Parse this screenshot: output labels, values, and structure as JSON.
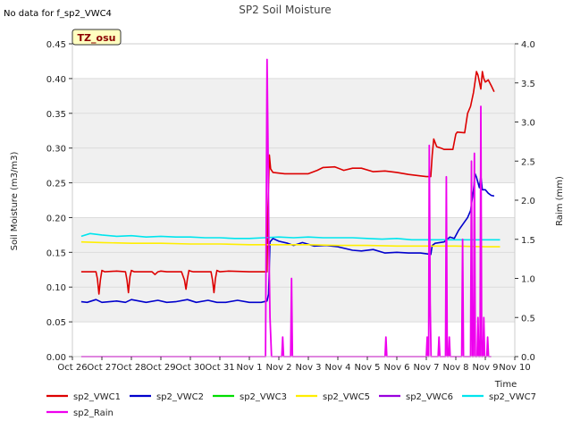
{
  "chart_data": {
    "type": "line",
    "title": "SP2 Soil Moisture",
    "nodata_note": "No data for f_sp2_VWC4",
    "station_tag": "TZ_osu",
    "xlabel": "Time",
    "ylabel": "Soil Moisture (m3/m3)",
    "y2label": "Raim (mm)",
    "xlim": [
      0,
      15
    ],
    "ylim": [
      0.0,
      0.45
    ],
    "y2lim": [
      0.0,
      4.0
    ],
    "x_ticks": [
      0,
      1,
      2,
      3,
      4,
      5,
      6,
      7,
      8,
      9,
      10,
      11,
      12,
      13,
      14,
      15
    ],
    "x_tick_labels": [
      "Oct 26",
      "Oct 27",
      "Oct 28",
      "Oct 29",
      "Oct 30",
      "Oct 31",
      "Nov 1",
      "Nov 2",
      "Nov 3",
      "Nov 4",
      "Nov 5",
      "Nov 6",
      "Nov 7",
      "Nov 8",
      "Nov 9",
      "Nov 10"
    ],
    "y_ticks": [
      0.0,
      0.05,
      0.1,
      0.15,
      0.2,
      0.25,
      0.3,
      0.35,
      0.4,
      0.45
    ],
    "y_tick_labels": [
      "0.00",
      "0.05",
      "0.10",
      "0.15",
      "0.20",
      "0.25",
      "0.30",
      "0.35",
      "0.40",
      "0.45"
    ],
    "y2_ticks": [
      0.0,
      0.5,
      1.0,
      1.5,
      2.0,
      2.5,
      3.0,
      3.5,
      4.0
    ],
    "y2_tick_labels": [
      "0.0",
      "0.5",
      "1.0",
      "1.5",
      "2.0",
      "2.5",
      "3.0",
      "3.5",
      "4.0"
    ],
    "grid": "horizontal bands",
    "legend_position": "bottom",
    "series": [
      {
        "name": "sp2_VWC1",
        "color": "#dd0000",
        "axis": "left",
        "x": [
          0.3,
          0.8,
          0.85,
          0.9,
          0.95,
          1.0,
          1.1,
          1.5,
          1.8,
          1.85,
          1.9,
          1.95,
          2.0,
          2.1,
          2.7,
          2.8,
          2.9,
          3.0,
          3.2,
          3.7,
          3.8,
          3.85,
          3.9,
          3.95,
          4.0,
          4.1,
          4.7,
          4.75,
          4.8,
          4.85,
          4.9,
          5.0,
          5.3,
          6.0,
          6.6,
          6.62,
          6.68,
          6.72,
          6.8,
          7.2,
          7.6,
          8.0,
          8.3,
          8.5,
          8.9,
          9.2,
          9.5,
          9.8,
          10.2,
          10.6,
          11.0,
          11.4,
          11.8,
          12.0,
          12.15,
          12.2,
          12.25,
          12.35,
          12.5,
          12.6,
          12.9,
          13.0,
          13.05,
          13.3,
          13.4,
          13.5,
          13.6,
          13.65,
          13.7,
          13.75,
          13.8,
          13.85,
          13.9,
          13.95,
          14.0,
          14.1,
          14.2,
          14.3
        ],
        "y": [
          0.122,
          0.122,
          0.112,
          0.09,
          0.11,
          0.124,
          0.122,
          0.123,
          0.122,
          0.11,
          0.092,
          0.115,
          0.124,
          0.122,
          0.122,
          0.118,
          0.122,
          0.123,
          0.122,
          0.122,
          0.11,
          0.097,
          0.112,
          0.124,
          0.123,
          0.122,
          0.122,
          0.11,
          0.092,
          0.112,
          0.124,
          0.122,
          0.123,
          0.122,
          0.122,
          0.2,
          0.29,
          0.27,
          0.265,
          0.263,
          0.263,
          0.263,
          0.268,
          0.272,
          0.273,
          0.268,
          0.271,
          0.271,
          0.266,
          0.267,
          0.265,
          0.262,
          0.26,
          0.259,
          0.259,
          0.29,
          0.313,
          0.302,
          0.3,
          0.298,
          0.298,
          0.32,
          0.323,
          0.322,
          0.35,
          0.36,
          0.38,
          0.395,
          0.41,
          0.405,
          0.395,
          0.385,
          0.41,
          0.4,
          0.395,
          0.398,
          0.39,
          0.381
        ]
      },
      {
        "name": "sp2_VWC2",
        "color": "#0000cc",
        "axis": "left",
        "x": [
          0.3,
          0.5,
          0.8,
          1.0,
          1.5,
          1.8,
          2.0,
          2.5,
          2.9,
          3.2,
          3.5,
          3.9,
          4.2,
          4.6,
          4.9,
          5.2,
          5.6,
          6.0,
          6.4,
          6.6,
          6.65,
          6.7,
          6.8,
          7.0,
          7.3,
          7.5,
          7.8,
          8.2,
          8.6,
          9.0,
          9.5,
          9.8,
          10.2,
          10.6,
          11.0,
          11.4,
          11.8,
          12.0,
          12.15,
          12.2,
          12.3,
          12.6,
          12.8,
          12.95,
          13.1,
          13.4,
          13.5,
          13.6,
          13.65,
          13.7,
          13.8,
          13.85,
          13.9,
          14.0,
          14.1,
          14.2,
          14.3
        ],
        "y": [
          0.079,
          0.078,
          0.082,
          0.078,
          0.08,
          0.078,
          0.082,
          0.078,
          0.081,
          0.078,
          0.079,
          0.082,
          0.078,
          0.081,
          0.078,
          0.078,
          0.081,
          0.078,
          0.078,
          0.08,
          0.09,
          0.165,
          0.17,
          0.166,
          0.163,
          0.16,
          0.164,
          0.159,
          0.16,
          0.158,
          0.153,
          0.152,
          0.154,
          0.149,
          0.15,
          0.149,
          0.149,
          0.148,
          0.147,
          0.16,
          0.163,
          0.165,
          0.172,
          0.17,
          0.182,
          0.2,
          0.21,
          0.24,
          0.263,
          0.258,
          0.243,
          0.26,
          0.24,
          0.24,
          0.235,
          0.232,
          0.231
        ],
        "style": "step"
      },
      {
        "name": "sp2_VWC3",
        "color": "#00dd00",
        "axis": "left",
        "x": [],
        "y": []
      },
      {
        "name": "sp2_VWC5",
        "color": "#ffee00",
        "axis": "left",
        "x": [
          0.3,
          1.0,
          2.0,
          3.0,
          4.0,
          5.0,
          6.0,
          7.0,
          8.0,
          9.0,
          10.0,
          11.0,
          12.0,
          13.0,
          14.0,
          14.5
        ],
        "y": [
          0.165,
          0.164,
          0.163,
          0.163,
          0.162,
          0.162,
          0.161,
          0.161,
          0.161,
          0.16,
          0.16,
          0.159,
          0.159,
          0.159,
          0.158,
          0.158
        ]
      },
      {
        "name": "sp2_VWC6",
        "color": "#9900dd",
        "axis": "left",
        "x": [],
        "y": []
      },
      {
        "name": "sp2_VWC7",
        "color": "#00e5ee",
        "axis": "left",
        "x": [
          0.3,
          0.6,
          1.0,
          1.5,
          2.0,
          2.5,
          3.0,
          3.5,
          4.0,
          4.5,
          5.0,
          5.5,
          6.0,
          6.5,
          7.0,
          7.5,
          8.0,
          8.5,
          9.0,
          9.5,
          10.0,
          10.5,
          11.0,
          11.5,
          12.0,
          12.5,
          13.0,
          13.5,
          14.0,
          14.5
        ],
        "y": [
          0.173,
          0.177,
          0.175,
          0.173,
          0.174,
          0.172,
          0.173,
          0.172,
          0.172,
          0.171,
          0.171,
          0.17,
          0.17,
          0.171,
          0.172,
          0.171,
          0.172,
          0.171,
          0.171,
          0.171,
          0.17,
          0.169,
          0.17,
          0.168,
          0.168,
          0.168,
          0.168,
          0.168,
          0.168,
          0.168
        ]
      },
      {
        "name": "sp2_Rain",
        "color": "#ee00ee",
        "axis": "right",
        "x": [
          0.3,
          6.55,
          6.6,
          6.63,
          6.66,
          6.7,
          6.75,
          6.8,
          7.1,
          7.13,
          7.16,
          7.4,
          7.43,
          7.46,
          10.6,
          10.63,
          10.66,
          12.0,
          12.03,
          12.06,
          12.08,
          12.1,
          12.13,
          12.16,
          12.4,
          12.43,
          12.46,
          12.65,
          12.68,
          12.71,
          12.75,
          12.78,
          12.81,
          13.2,
          13.23,
          13.26,
          13.5,
          13.53,
          13.56,
          13.6,
          13.63,
          13.66,
          13.72,
          13.75,
          13.78,
          13.82,
          13.85,
          13.88,
          13.92,
          13.95,
          13.98,
          14.05,
          14.08,
          14.11,
          14.2
        ],
        "y": [
          0,
          0,
          3.8,
          2.8,
          1.5,
          0.5,
          0,
          0,
          0,
          0.25,
          0,
          0,
          1.0,
          0,
          0,
          0.25,
          0,
          0,
          0.25,
          0,
          0,
          2.7,
          0.7,
          0,
          0,
          0.25,
          0,
          0,
          2.3,
          0,
          0,
          0.25,
          0,
          0,
          1.5,
          0,
          0,
          2.5,
          0,
          0,
          2.6,
          0,
          0,
          0.5,
          0,
          0,
          3.2,
          0,
          0,
          0.5,
          0,
          0,
          0.25,
          0,
          0
        ]
      }
    ]
  }
}
